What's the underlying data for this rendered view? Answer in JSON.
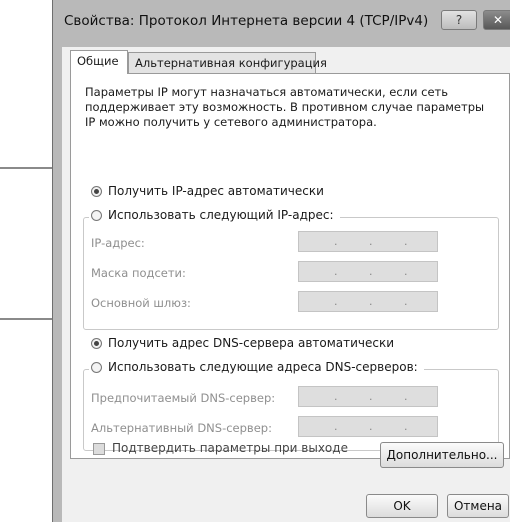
{
  "window": {
    "title": "Свойства: Протокол Интернета версии 4 (TCP/IPv4)",
    "help_label": "?",
    "close_label": "✕"
  },
  "tabs": [
    {
      "label": "Общие"
    },
    {
      "label": "Альтернативная конфигурация"
    }
  ],
  "description": "Параметры IP могут назначаться автоматически, если сеть поддерживает эту возможность. В противном случае параметры IP можно получить у сетевого администратора.",
  "ip": {
    "auto_label": "Получить IP-адрес автоматически",
    "auto_selected": true,
    "manual_label": "Использовать следующий IP-адрес:",
    "fields": [
      {
        "label": "IP-адрес:",
        "value": ". . ."
      },
      {
        "label": "Маска подсети:",
        "value": ". . ."
      },
      {
        "label": "Основной шлюз:",
        "value": ". . ."
      }
    ]
  },
  "dns": {
    "auto_label": "Получить адрес DNS-сервера автоматически",
    "auto_selected": true,
    "manual_label": "Использовать следующие адреса DNS-серверов:",
    "fields": [
      {
        "label": "Предпочитаемый DNS-сервер:",
        "value": ". . ."
      },
      {
        "label": "Альтернативный DNS-сервер:",
        "value": ". . ."
      }
    ]
  },
  "validate_label": "Подтвердить параметры при выходе",
  "advanced_label": "Дополнительно...",
  "ok_label": "OK",
  "cancel_label": "Отмена"
}
